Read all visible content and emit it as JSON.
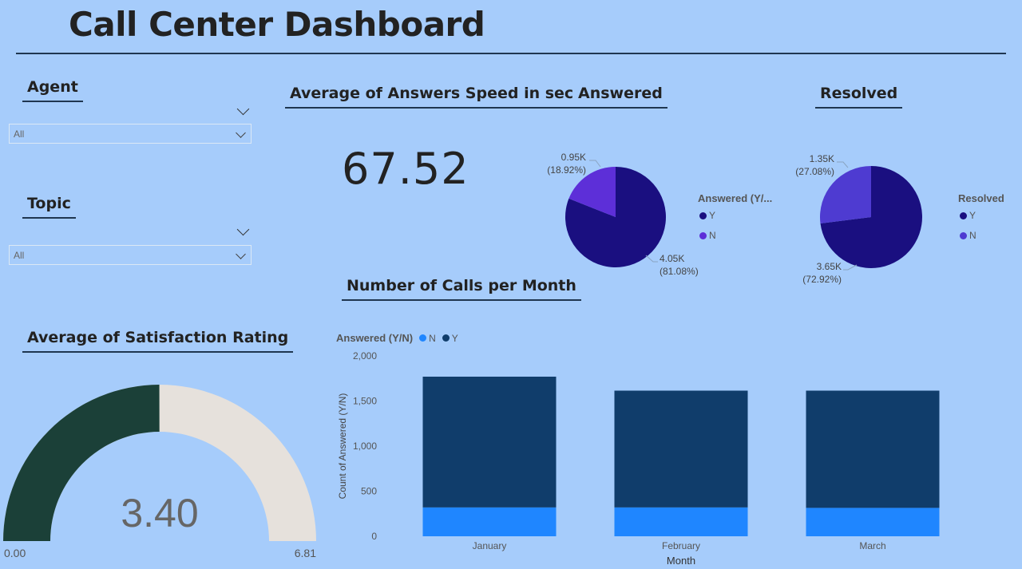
{
  "header": {
    "title": "Call Center Dashboard"
  },
  "colors": {
    "answered_y": "#1a0f80",
    "answered_n": "#5d2fd8",
    "resolved_n": "#4e3bd1",
    "bar_y": "#103d6b",
    "bar_n": "#1f86ff",
    "gauge_fill": "#1b4038",
    "gauge_bg": "#e6e1dc",
    "background": "#a6ccfb"
  },
  "slicers": {
    "agent": {
      "label": "Agent",
      "value": "All"
    },
    "topic": {
      "label": "Topic",
      "value": "All"
    }
  },
  "kpi_speed": {
    "title": "Average of Answers Speed in sec",
    "value": "67.52"
  },
  "answered_card": {
    "title": "Answered",
    "legend_title": "Answered (Y/...",
    "legend": [
      "Y",
      "N"
    ]
  },
  "resolved_card": {
    "title": "Resolved",
    "legend_title": "Resolved",
    "legend": [
      "Y",
      "N"
    ]
  },
  "calls_card": {
    "title": "Number of Calls per Month",
    "legend_title": "Answered (Y/N)",
    "legend": [
      "N",
      "Y"
    ]
  },
  "satisfaction_card": {
    "title": "Average of Satisfaction Rating"
  },
  "chart_data": [
    {
      "type": "pie",
      "name": "Answered",
      "labels": [
        "Y",
        "N"
      ],
      "values": [
        4050,
        950
      ],
      "data_labels": [
        "4.05K",
        "0.95K"
      ],
      "percent_labels": [
        "(81.08%)",
        "(18.92%)"
      ],
      "legend_title": "Answered (Y/..."
    },
    {
      "type": "pie",
      "name": "Resolved",
      "labels": [
        "Y",
        "N"
      ],
      "values": [
        3650,
        1350
      ],
      "data_labels": [
        "3.65K",
        "1.35K"
      ],
      "percent_labels": [
        "(72.92%)",
        "(27.08%)"
      ],
      "legend_title": "Resolved"
    },
    {
      "type": "bar",
      "stacked": true,
      "title": "Number of Calls per Month",
      "categories": [
        "January",
        "February",
        "March"
      ],
      "series": [
        {
          "name": "N",
          "values": [
            320,
            320,
            315
          ]
        },
        {
          "name": "Y",
          "values": [
            1450,
            1295,
            1300
          ]
        }
      ],
      "xlabel": "Month",
      "ylabel": "Count of Answered (Y/N)",
      "ylim": [
        0,
        2000
      ],
      "yticks": [
        "0",
        "500",
        "1,000",
        "1,500",
        "2,000"
      ],
      "legend_title": "Answered (Y/N)"
    },
    {
      "type": "gauge",
      "title": "Average of Satisfaction Rating",
      "value": 3.4,
      "min": 0,
      "max": 6.81,
      "value_label": "3.40",
      "min_label": "0.00",
      "max_label": "6.81"
    }
  ]
}
